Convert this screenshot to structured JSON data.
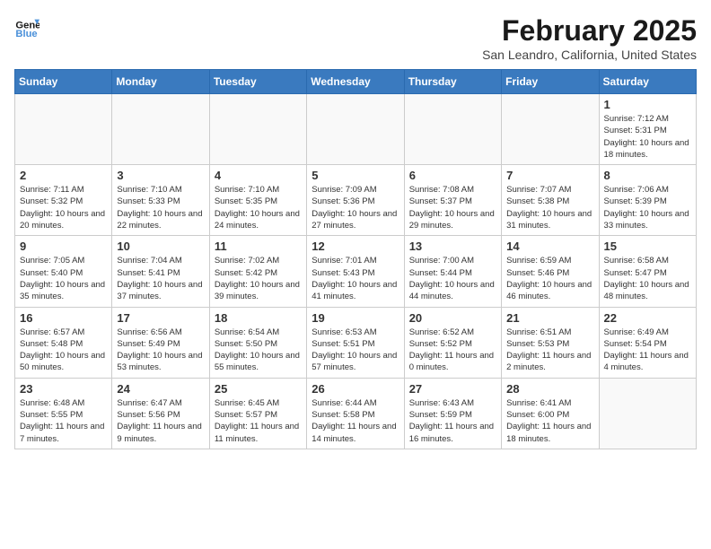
{
  "header": {
    "logo_line1": "General",
    "logo_line2": "Blue",
    "month": "February 2025",
    "location": "San Leandro, California, United States"
  },
  "weekdays": [
    "Sunday",
    "Monday",
    "Tuesday",
    "Wednesday",
    "Thursday",
    "Friday",
    "Saturday"
  ],
  "weeks": [
    [
      {
        "day": "",
        "info": ""
      },
      {
        "day": "",
        "info": ""
      },
      {
        "day": "",
        "info": ""
      },
      {
        "day": "",
        "info": ""
      },
      {
        "day": "",
        "info": ""
      },
      {
        "day": "",
        "info": ""
      },
      {
        "day": "1",
        "info": "Sunrise: 7:12 AM\nSunset: 5:31 PM\nDaylight: 10 hours and 18 minutes."
      }
    ],
    [
      {
        "day": "2",
        "info": "Sunrise: 7:11 AM\nSunset: 5:32 PM\nDaylight: 10 hours and 20 minutes."
      },
      {
        "day": "3",
        "info": "Sunrise: 7:10 AM\nSunset: 5:33 PM\nDaylight: 10 hours and 22 minutes."
      },
      {
        "day": "4",
        "info": "Sunrise: 7:10 AM\nSunset: 5:35 PM\nDaylight: 10 hours and 24 minutes."
      },
      {
        "day": "5",
        "info": "Sunrise: 7:09 AM\nSunset: 5:36 PM\nDaylight: 10 hours and 27 minutes."
      },
      {
        "day": "6",
        "info": "Sunrise: 7:08 AM\nSunset: 5:37 PM\nDaylight: 10 hours and 29 minutes."
      },
      {
        "day": "7",
        "info": "Sunrise: 7:07 AM\nSunset: 5:38 PM\nDaylight: 10 hours and 31 minutes."
      },
      {
        "day": "8",
        "info": "Sunrise: 7:06 AM\nSunset: 5:39 PM\nDaylight: 10 hours and 33 minutes."
      }
    ],
    [
      {
        "day": "9",
        "info": "Sunrise: 7:05 AM\nSunset: 5:40 PM\nDaylight: 10 hours and 35 minutes."
      },
      {
        "day": "10",
        "info": "Sunrise: 7:04 AM\nSunset: 5:41 PM\nDaylight: 10 hours and 37 minutes."
      },
      {
        "day": "11",
        "info": "Sunrise: 7:02 AM\nSunset: 5:42 PM\nDaylight: 10 hours and 39 minutes."
      },
      {
        "day": "12",
        "info": "Sunrise: 7:01 AM\nSunset: 5:43 PM\nDaylight: 10 hours and 41 minutes."
      },
      {
        "day": "13",
        "info": "Sunrise: 7:00 AM\nSunset: 5:44 PM\nDaylight: 10 hours and 44 minutes."
      },
      {
        "day": "14",
        "info": "Sunrise: 6:59 AM\nSunset: 5:46 PM\nDaylight: 10 hours and 46 minutes."
      },
      {
        "day": "15",
        "info": "Sunrise: 6:58 AM\nSunset: 5:47 PM\nDaylight: 10 hours and 48 minutes."
      }
    ],
    [
      {
        "day": "16",
        "info": "Sunrise: 6:57 AM\nSunset: 5:48 PM\nDaylight: 10 hours and 50 minutes."
      },
      {
        "day": "17",
        "info": "Sunrise: 6:56 AM\nSunset: 5:49 PM\nDaylight: 10 hours and 53 minutes."
      },
      {
        "day": "18",
        "info": "Sunrise: 6:54 AM\nSunset: 5:50 PM\nDaylight: 10 hours and 55 minutes."
      },
      {
        "day": "19",
        "info": "Sunrise: 6:53 AM\nSunset: 5:51 PM\nDaylight: 10 hours and 57 minutes."
      },
      {
        "day": "20",
        "info": "Sunrise: 6:52 AM\nSunset: 5:52 PM\nDaylight: 11 hours and 0 minutes."
      },
      {
        "day": "21",
        "info": "Sunrise: 6:51 AM\nSunset: 5:53 PM\nDaylight: 11 hours and 2 minutes."
      },
      {
        "day": "22",
        "info": "Sunrise: 6:49 AM\nSunset: 5:54 PM\nDaylight: 11 hours and 4 minutes."
      }
    ],
    [
      {
        "day": "23",
        "info": "Sunrise: 6:48 AM\nSunset: 5:55 PM\nDaylight: 11 hours and 7 minutes."
      },
      {
        "day": "24",
        "info": "Sunrise: 6:47 AM\nSunset: 5:56 PM\nDaylight: 11 hours and 9 minutes."
      },
      {
        "day": "25",
        "info": "Sunrise: 6:45 AM\nSunset: 5:57 PM\nDaylight: 11 hours and 11 minutes."
      },
      {
        "day": "26",
        "info": "Sunrise: 6:44 AM\nSunset: 5:58 PM\nDaylight: 11 hours and 14 minutes."
      },
      {
        "day": "27",
        "info": "Sunrise: 6:43 AM\nSunset: 5:59 PM\nDaylight: 11 hours and 16 minutes."
      },
      {
        "day": "28",
        "info": "Sunrise: 6:41 AM\nSunset: 6:00 PM\nDaylight: 11 hours and 18 minutes."
      },
      {
        "day": "",
        "info": ""
      }
    ]
  ]
}
